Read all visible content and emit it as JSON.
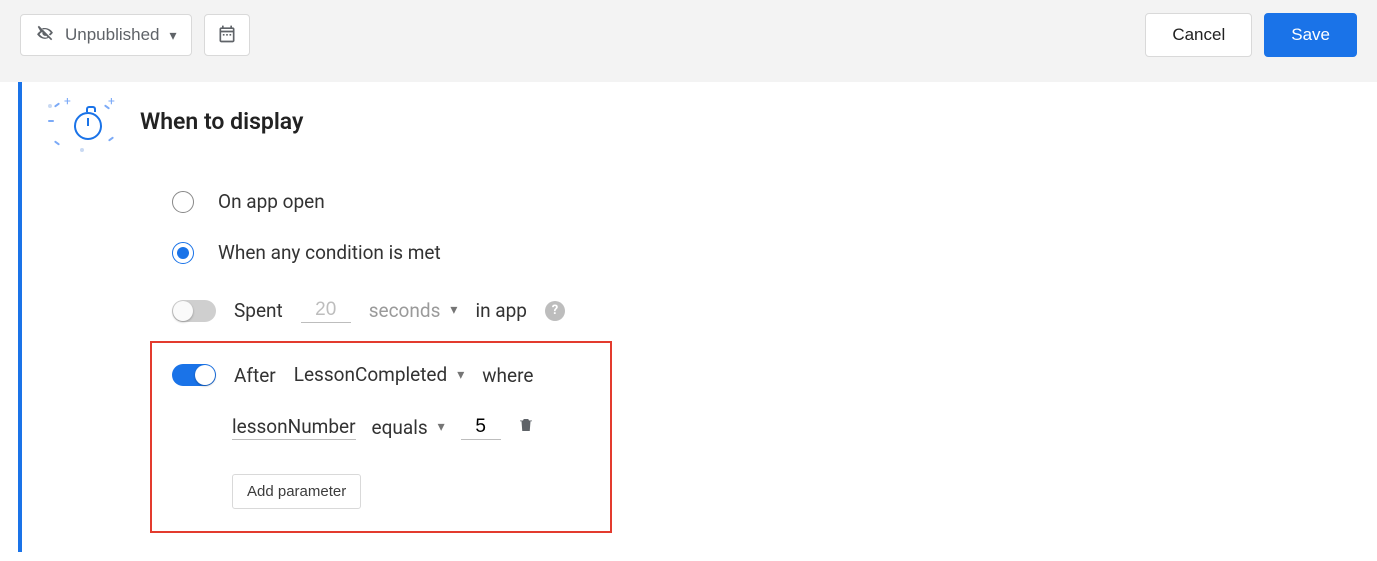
{
  "topbar": {
    "status_label": "Unpublished",
    "cancel_label": "Cancel",
    "save_label": "Save"
  },
  "section": {
    "title": "When to display",
    "radio_on_open": "On app open",
    "radio_condition": "When any condition is met",
    "selected_radio": "condition"
  },
  "cond_spent": {
    "enabled": false,
    "spent_label": "Spent",
    "duration_value": "20",
    "unit_label": "seconds",
    "suffix_label": "in app"
  },
  "cond_event": {
    "enabled": true,
    "prefix_label": "After",
    "event_name": "LessonCompleted",
    "where_label": "where",
    "param_name": "lessonNumber",
    "operator_label": "equals",
    "param_value": "5",
    "add_param_label": "Add parameter"
  }
}
